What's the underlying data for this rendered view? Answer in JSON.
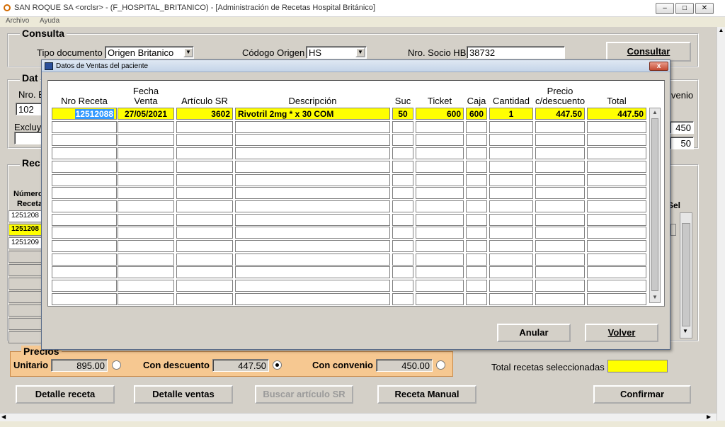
{
  "window": {
    "title": "SAN ROQUE SA <orclsr> - (F_HOSPITAL_BRITANICO) - [Administración de Recetas Hospital Británico]"
  },
  "menu": [
    "Archivo",
    "Ayuda"
  ],
  "consulta": {
    "title": "Consulta",
    "tipo_documento_label": "Tipo documento",
    "tipo_documento_value": "Origen Britanico",
    "codigo_origen_label": "Códogo Origen",
    "codigo_origen_value": "HS",
    "nro_socio_label": "Nro. Socio HB",
    "nro_socio_value": "38732",
    "consultar_label": "Consultar"
  },
  "datos_partial": {
    "title": "Dat",
    "nro_label": "Nro. E",
    "nro_value": "102",
    "excluye_label": "Excluye",
    "convenio_label": "venio",
    "right_value_1": "450",
    "right_value_2": "50"
  },
  "recetas_partial": {
    "title": "Rec",
    "col_numero": "Número",
    "col_receta": "Receta",
    "rows": [
      "1251208",
      "1251208",
      "1251209"
    ],
    "sel_label": "Sel"
  },
  "dialog": {
    "title": "Datos de Ventas del paciente",
    "close_symbol": "x",
    "headers": {
      "nro_receta": "Nro Receta",
      "fecha_venta_1": "Fecha",
      "fecha_venta_2": "Venta",
      "articulo_sr": "Artículo SR",
      "descripcion": "Descripción",
      "suc": "Suc",
      "ticket": "Ticket",
      "caja": "Caja",
      "cantidad": "Cantidad",
      "precio_1": "Precio",
      "precio_2": "c/descuento",
      "total": "Total"
    },
    "row": {
      "nro_receta": "12512088",
      "fecha_venta": "27/05/2021",
      "articulo_sr": "3602",
      "descripcion": "Rivotril 2mg * x 30 COM",
      "suc": "50",
      "ticket": "600",
      "caja": "600",
      "cantidad": "1",
      "precio_descuento": "447.50",
      "total": "447.50"
    },
    "anular_label": "Anular",
    "volver_label": "Volver"
  },
  "precios": {
    "title": "Precios",
    "unitario_label": "Unitario",
    "unitario_value": "895.00",
    "con_descuento_label": "Con descuento",
    "con_descuento_value": "447.50",
    "con_convenio_label": "Con convenio",
    "con_convenio_value": "450.00"
  },
  "total_recetas_label": "Total recetas seleccionadas",
  "bottom_buttons": {
    "detalle_receta": "Detalle receta",
    "detalle_ventas": "Detalle ventas",
    "buscar_articulo": "Buscar artículo SR",
    "receta_manual": "Receta Manual",
    "confirmar": "Confirmar"
  },
  "colors": {
    "highlight": "#ffff00",
    "precios_bg": "#f6c891",
    "face": "#d4d0c8"
  }
}
